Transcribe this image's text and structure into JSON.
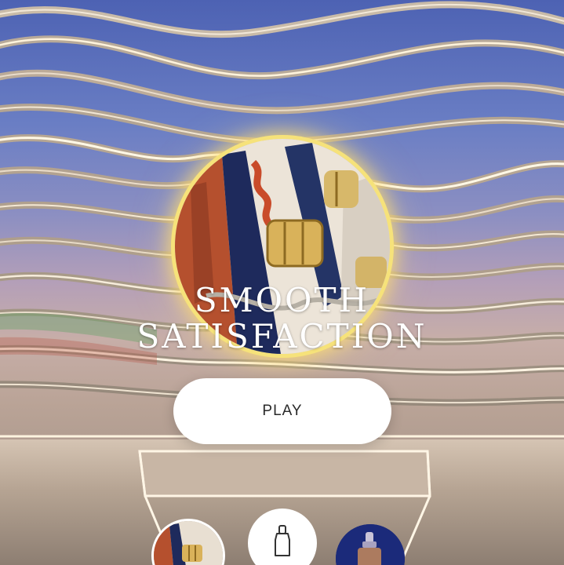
{
  "title": {
    "line1": "SMOOTH",
    "line2": "SATISFACTION"
  },
  "play_button": {
    "label": "PLAY"
  },
  "selector": {
    "items": [
      {
        "icon": "medallion-thumbnail-icon",
        "selected": true
      },
      {
        "icon": "bottle-icon",
        "selected": false
      },
      {
        "icon": "serum-bottle-icon",
        "selected": false
      }
    ]
  },
  "colors": {
    "glow_ring": "#f6e27a",
    "button_bg": "#ffffff",
    "button_text": "#2a2a2a",
    "sky_top": "#4d62b3"
  }
}
